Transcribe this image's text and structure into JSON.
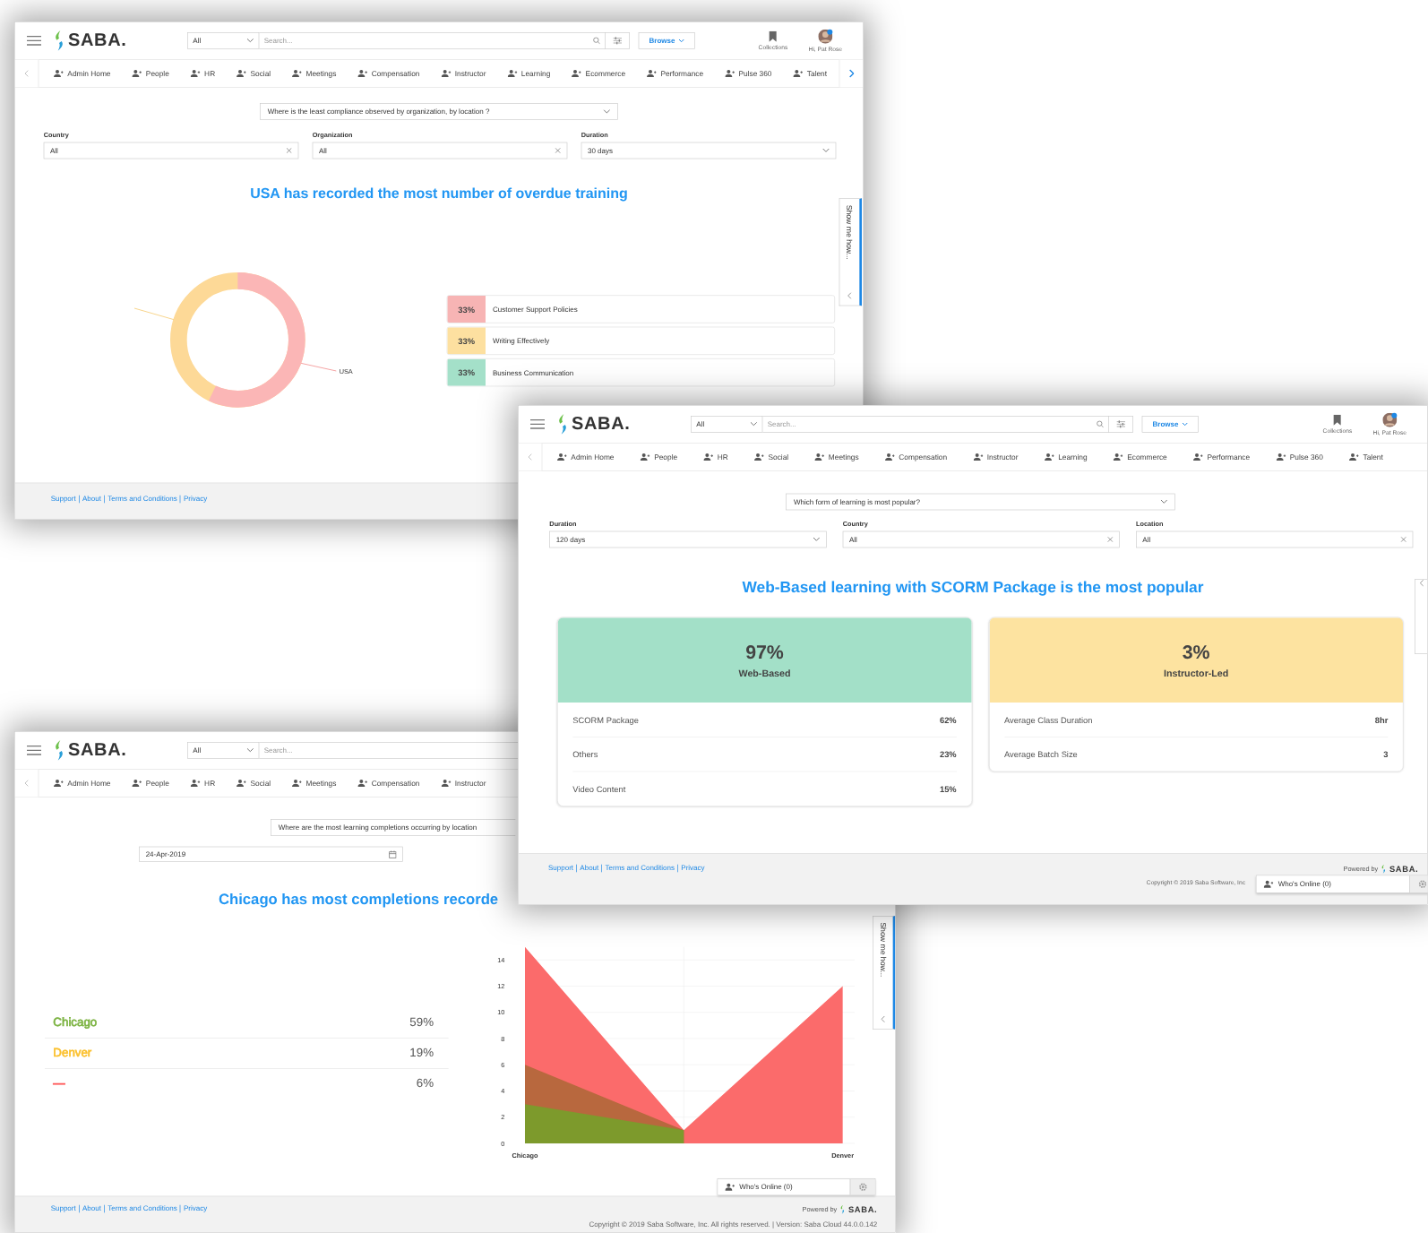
{
  "screens": [
    {
      "kind": "compliance",
      "top_bar": {
        "logo": "SABA.",
        "search_scope": "All",
        "search_placeholder": "Search...",
        "browse_button": "Browse",
        "collections": "Collections",
        "greeting": "Hi, Pat Rose"
      },
      "nav": {
        "items": [
          "Admin Home",
          "People",
          "HR",
          "Social",
          "Meetings",
          "Compensation",
          "Instructor",
          "Learning",
          "Ecommerce",
          "Performance",
          "Pulse 360",
          "Talent"
        ],
        "scroll_right": true
      },
      "question": "Where is the least compliance observed by organization, by location ?",
      "filters": [
        {
          "label": "Country",
          "value": "All",
          "kind": "clearable"
        },
        {
          "label": "Organization",
          "value": "All",
          "kind": "clearable"
        },
        {
          "label": "Duration",
          "value": "30 days",
          "kind": "dropdown"
        }
      ],
      "headline": "USA has recorded the most number of overdue training",
      "donut_label": "USA",
      "legend": [
        {
          "percent": "33%",
          "label": "Customer Support Policies",
          "color": "#f7b4b4"
        },
        {
          "percent": "33%",
          "label": "Writing Effectively",
          "color": "#fde0a0"
        },
        {
          "percent": "33%",
          "label": "Business Communication",
          "color": "#a4e0c9"
        }
      ],
      "help_tab": "Show me how...",
      "footer_links": [
        "Support",
        "About",
        "Terms and Conditions",
        "Privacy"
      ]
    },
    {
      "kind": "popularity",
      "top_bar": {
        "logo": "SABA.",
        "search_scope": "All",
        "search_placeholder": "Search...",
        "browse_button": "Browse",
        "collections": "Collections",
        "greeting": "Hi, Pat Rose"
      },
      "nav": {
        "items": [
          "Admin Home",
          "People",
          "HR",
          "Social",
          "Meetings",
          "Compensation",
          "Instructor",
          "Learning",
          "Ecommerce",
          "Performance",
          "Pulse 360",
          "Talent"
        ],
        "scroll_right": false
      },
      "question": "Which form of learning is most popular?",
      "filters": [
        {
          "label": "Duration",
          "value": "120 days",
          "kind": "dropdown"
        },
        {
          "label": "Country",
          "value": "All",
          "kind": "clearable"
        },
        {
          "label": "Location",
          "value": "All",
          "kind": "clearable"
        }
      ],
      "headline": "Web-Based learning with SCORM Package is the most popular",
      "cards": [
        {
          "percent": "97%",
          "label": "Web-Based",
          "color": "#a3e0c8",
          "rows": [
            {
              "name": "SCORM Package",
              "value": "62%"
            },
            {
              "name": "Others",
              "value": "23%"
            },
            {
              "name": "Video Content",
              "value": "15%"
            }
          ]
        },
        {
          "percent": "3%",
          "label": "Instructor-Led",
          "color": "#fde3a0",
          "rows": [
            {
              "name": "Average Class Duration",
              "value": "8hr"
            },
            {
              "name": "Average Batch Size",
              "value": "3"
            }
          ]
        }
      ],
      "footer_links": [
        "Support",
        "About",
        "Terms and Conditions",
        "Privacy"
      ],
      "powered_by": "Powered by",
      "footer_logo": "SABA.",
      "copyright": "Copyright © 2019 Saba Software, Inc",
      "whos_online": "Who's Online (0)"
    },
    {
      "kind": "completions",
      "top_bar": {
        "logo": "SABA.",
        "search_scope": "All",
        "search_placeholder": "Search..."
      },
      "nav": {
        "items": [
          "Admin Home",
          "People",
          "HR",
          "Social",
          "Meetings",
          "Compensation",
          "Instructor"
        ]
      },
      "question": "Where are the most learning completions occurring by location",
      "date": "24-Apr-2019",
      "headline": "Chicago has most completions recorde",
      "locations": [
        {
          "name": "Chicago",
          "value": "59%",
          "color": "#7cb342"
        },
        {
          "name": "Denver",
          "value": "19%",
          "color": "#fbc02d"
        },
        {
          "name": "—",
          "value": "6%",
          "color": "#ff5252"
        }
      ],
      "chart_data": {
        "type": "area",
        "categories": [
          "Chicago",
          null,
          "Denver"
        ],
        "ylim": [
          0,
          15
        ],
        "grid": true,
        "yticks": [
          0,
          2,
          4,
          6,
          8,
          10,
          12,
          14
        ],
        "series": [
          {
            "color": "#fb6b6b",
            "values": [
              15,
              1,
              12
            ]
          },
          {
            "color": "#b8683e",
            "values": [
              6,
              1,
              null
            ]
          },
          {
            "color": "#7d9a2c",
            "values": [
              3,
              1,
              null
            ]
          }
        ]
      },
      "help_tab": "Show me how...",
      "whos_online": "Who's Online (0)",
      "footer_links": [
        "Support",
        "About",
        "Terms and Conditions",
        "Privacy"
      ],
      "powered_by": "Powered by",
      "footer_logo": "SABA.",
      "copyright": "Copyright © 2019 Saba Software, Inc. All rights reserved. | Version: Saba Cloud 44.0.0.142"
    }
  ]
}
